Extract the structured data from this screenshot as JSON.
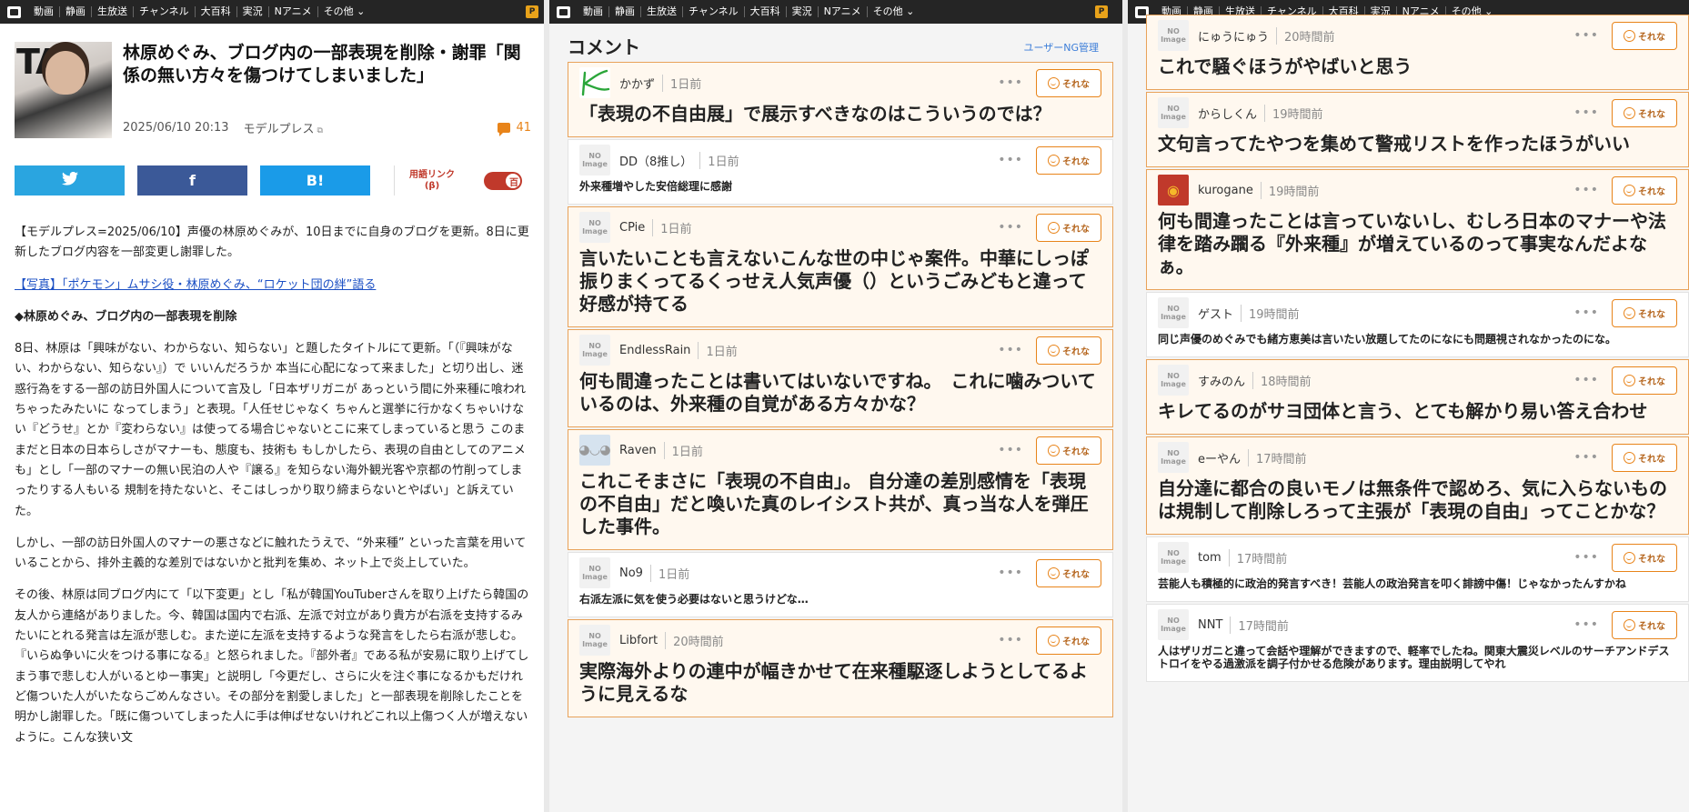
{
  "nav": {
    "items": [
      "動画",
      "静画",
      "生放送",
      "チャンネル",
      "大百科",
      "実況",
      "Nアニメ",
      "その他"
    ],
    "badge": "P"
  },
  "article": {
    "title": "林原めぐみ、ブログ内の一部表現を削除・謝罪「関係の無い方々を傷つけてしまいました」",
    "date": "2025/06/10 20:13",
    "source": "モデルプレス",
    "comment_count": "41",
    "share": {
      "twitter": "🐦",
      "facebook": "f",
      "hatena": "B!"
    },
    "glossary_label": "用語リンク (β)",
    "toggle_label": "百",
    "paragraphs": [
      "【モデルプレス=2025/06/10】声優の林原めぐみが、10日までに自身のブログを更新。8日に更新したブログ内容を一部変更し謝罪した。",
      "【写真】「ポケモン」ムサシ役・林原めぐみ、“ロケット団の絆”語る",
      "◆林原めぐみ、ブログ内の一部表現を削除",
      "8日、林原は「興味がない、わからない、知らない」と題したタイトルにて更新。「（『興味がない、わからない、知らない』）で いいんだろうか 本当に心配になって来ました」と切り出し、迷惑行為をする一部の訪日外国人について言及し「日本ザリガニが あっという間に外来種に喰われちゃったみたいに なってしまう」と表現。「人任せじゃなく ちゃんと選挙に行かなくちゃいけない『どうせ』とか『変わらない』は使ってる場合じゃないとこに来てしまっていると思う このままだと日本の日本らしさがマナーも、態度も、技術も もしかしたら、表現の自由としてのアニメも」とし「一部のマナーの無い民泊の人や『譲る』を知らない海外観光客や京都の竹削ってしまったりする人もいる 規制を持たないと、そこはしっかり取り締まらないとやばい」と訴えていた。",
      "しかし、一部の訪日外国人のマナーの悪さなどに触れたうえで、“外来種” といった言葉を用いていることから、排外主義的な差別ではないかと批判を集め、ネット上で炎上していた。",
      "その後、林原は同ブログ内にて「以下変更」とし「私が韓国YouTuberさんを取り上げたら韓国の友人から連絡がありました。今、韓国は国内で右派、左派で対立があり貴方が右派を支持するみたいにとれる発言は左派が悲しむ。また逆に左派を支持するような発言をしたら右派が悲しむ。『いらぬ争いに火をつける事になる』と怒られました。『部外者』である私が安易に取り上げてしまう事で悲しむ人がいるとゆー事実」と説明し「今更だし、さらに火を注ぐ事になるかもだけれど傷ついた人がいたならごめんなさい。その部分を割愛しました」と一部表現を削除したことを明かし謝罪した。「既に傷ついてしまった人に手は伸ばせないけれどこれ以上傷つく人が増えないように。こんな狭い文"
    ]
  },
  "comments_pane": {
    "title": "コメント",
    "ng_link": "ユーザーNG管理",
    "reaction_label": "それな",
    "comments": [
      {
        "name": "かかず",
        "time": "1日前",
        "text": "「表現の不自由展」で展示すべきなのはこういうのでは？",
        "style": "big",
        "highlight": true,
        "avatar": "kakazu"
      },
      {
        "name": "DD（8推し）",
        "time": "1日前",
        "text": "外来種増やした安倍総理に感謝",
        "style": "small",
        "highlight": false,
        "avatar": "noimage"
      },
      {
        "name": "CPie",
        "time": "1日前",
        "text": "言いたいことも言えないこんな世の中じゃ案件。中華にしっぽ振りまくってるくっせえ人気声優（）というごみどもと違って好感が持てる",
        "style": "big",
        "highlight": true,
        "avatar": "noimage"
      },
      {
        "name": "EndlessRain",
        "time": "1日前",
        "text": "何も間違ったことは書いてはいないですね。　これに噛みついているのは、外来種の自覚がある方々かな？",
        "style": "big",
        "highlight": true,
        "avatar": "noimage"
      },
      {
        "name": "Raven",
        "time": "1日前",
        "text": "これこそまさに「表現の不自由」。 自分達の差別感情を「表現の不自由」だと喚いた真のレイシスト共が、真っ当な人を弾圧した事件。",
        "style": "big",
        "highlight": true,
        "avatar": "raven"
      },
      {
        "name": "No9",
        "time": "1日前",
        "text": "右派左派に気を使う必要はないと思うけどな…",
        "style": "small",
        "highlight": false,
        "avatar": "noimage"
      },
      {
        "name": "Libfort",
        "time": "20時間前",
        "text": "実際海外よりの連中が幅きかせて在来種駆逐しようとしてるように見えるな",
        "style": "big",
        "highlight": true,
        "avatar": "noimage"
      }
    ]
  },
  "comments_pane2": {
    "comments": [
      {
        "name": "にゅうにゅう",
        "time": "20時間前",
        "text": "これで騒ぐほうがやばいと思う",
        "style": "big",
        "highlight": true,
        "avatar": "noimage"
      },
      {
        "name": "からしくん",
        "time": "19時間前",
        "text": "文句言ってたやつを集めて警戒リストを作ったほうがいい",
        "style": "big",
        "highlight": true,
        "avatar": "noimage"
      },
      {
        "name": "kurogane",
        "time": "19時間前",
        "text": "何も間違ったことは言っていないし、むしろ日本のマナーや法律を踏み躙る『外来種』が増えているのって事実なんだよなぁ。",
        "style": "big",
        "highlight": true,
        "avatar": "kuro"
      },
      {
        "name": "ゲスト",
        "time": "19時間前",
        "text": "同じ声優のめぐみでも緒方恵美は言いたい放題してたのになにも問題視されなかったのにな。",
        "style": "small",
        "highlight": false,
        "avatar": "noimage"
      },
      {
        "name": "すみのん",
        "time": "18時間前",
        "text": "キレてるのがサヨ団体と言う、とても解かり易い答え合わせ",
        "style": "big",
        "highlight": true,
        "avatar": "noimage"
      },
      {
        "name": "eーやん",
        "time": "17時間前",
        "text": "自分達に都合の良いモノは無条件で認めろ、気に入らないものは規制して削除しろって主張が「表現の自由」ってことかな？",
        "style": "big",
        "highlight": true,
        "avatar": "noimage"
      },
      {
        "name": "tom",
        "time": "17時間前",
        "text": "芸能人も積極的に政治的発言すべき！芸能人の政治発言を叩く誹謗中傷！じゃなかったんすかね",
        "style": "small",
        "highlight": false,
        "avatar": "noimage"
      },
      {
        "name": "NNT",
        "time": "17時間前",
        "text": "人はザリガニと違って会話や理解ができますので、軽率でしたね。関東大震災レベルのサーチアンドデストロイをやる過激派を調子付かせる危険があります。理由説明してやれ",
        "style": "small",
        "highlight": false,
        "avatar": "noimage"
      }
    ]
  },
  "colors": {
    "accent": "#e8841a",
    "navbar": "#252525",
    "link": "#1b4fc4"
  }
}
